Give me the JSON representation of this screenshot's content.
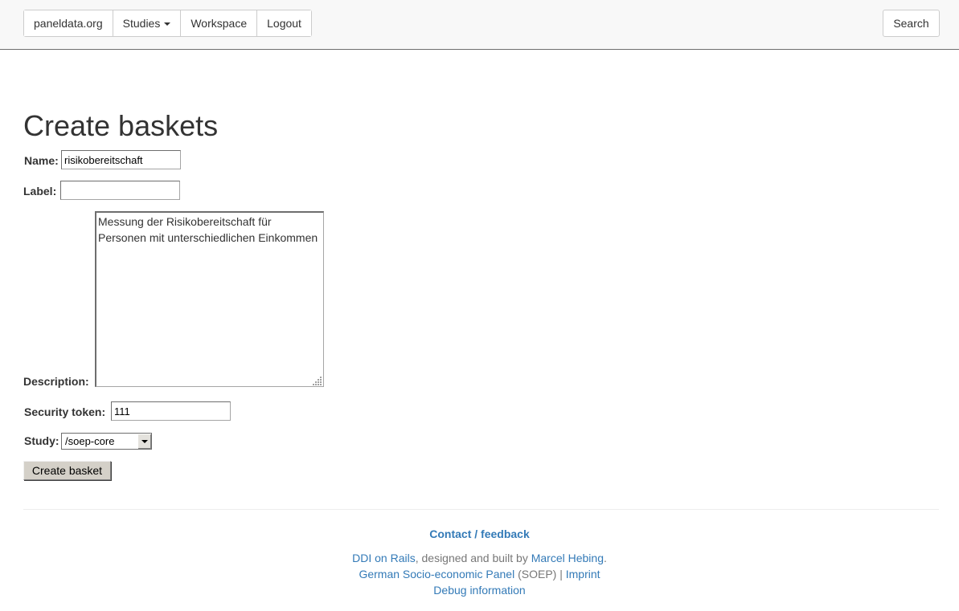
{
  "nav": {
    "brand": "paneldata.org",
    "studies": "Studies",
    "workspace": "Workspace",
    "logout": "Logout",
    "search": "Search"
  },
  "page": {
    "title": "Create baskets"
  },
  "form": {
    "name_label": "Name:",
    "name_value": "risikobereitschaft",
    "label_label": "Label:",
    "label_value": "",
    "description_label": "Description:",
    "description_value": "Messung der Risikobereitschaft für Personen mit unterschiedlichen Einkommen",
    "token_label": "Security token:",
    "token_value": "111",
    "study_label": "Study:",
    "study_value": "/soep-core",
    "submit_label": "Create basket"
  },
  "footer": {
    "contact": "Contact / feedback",
    "ddi_link": "DDI on Rails",
    "designed_text": ", designed and built by ",
    "author_link": "Marcel Hebing",
    "period": ".",
    "soep_link": "German Socio-economic Panel",
    "soep_abbr": " (SOEP) | ",
    "imprint_link": "Imprint",
    "debug_link": "Debug information"
  },
  "icons": {
    "studies_caret": "caret-down-icon",
    "select_arrow": "chevron-down-icon",
    "resize_grip": "resize-grip-icon"
  },
  "colors": {
    "link": "#337ab7",
    "navbar_bg": "#f8f8f8",
    "button_bg": "#d4d0c8"
  }
}
